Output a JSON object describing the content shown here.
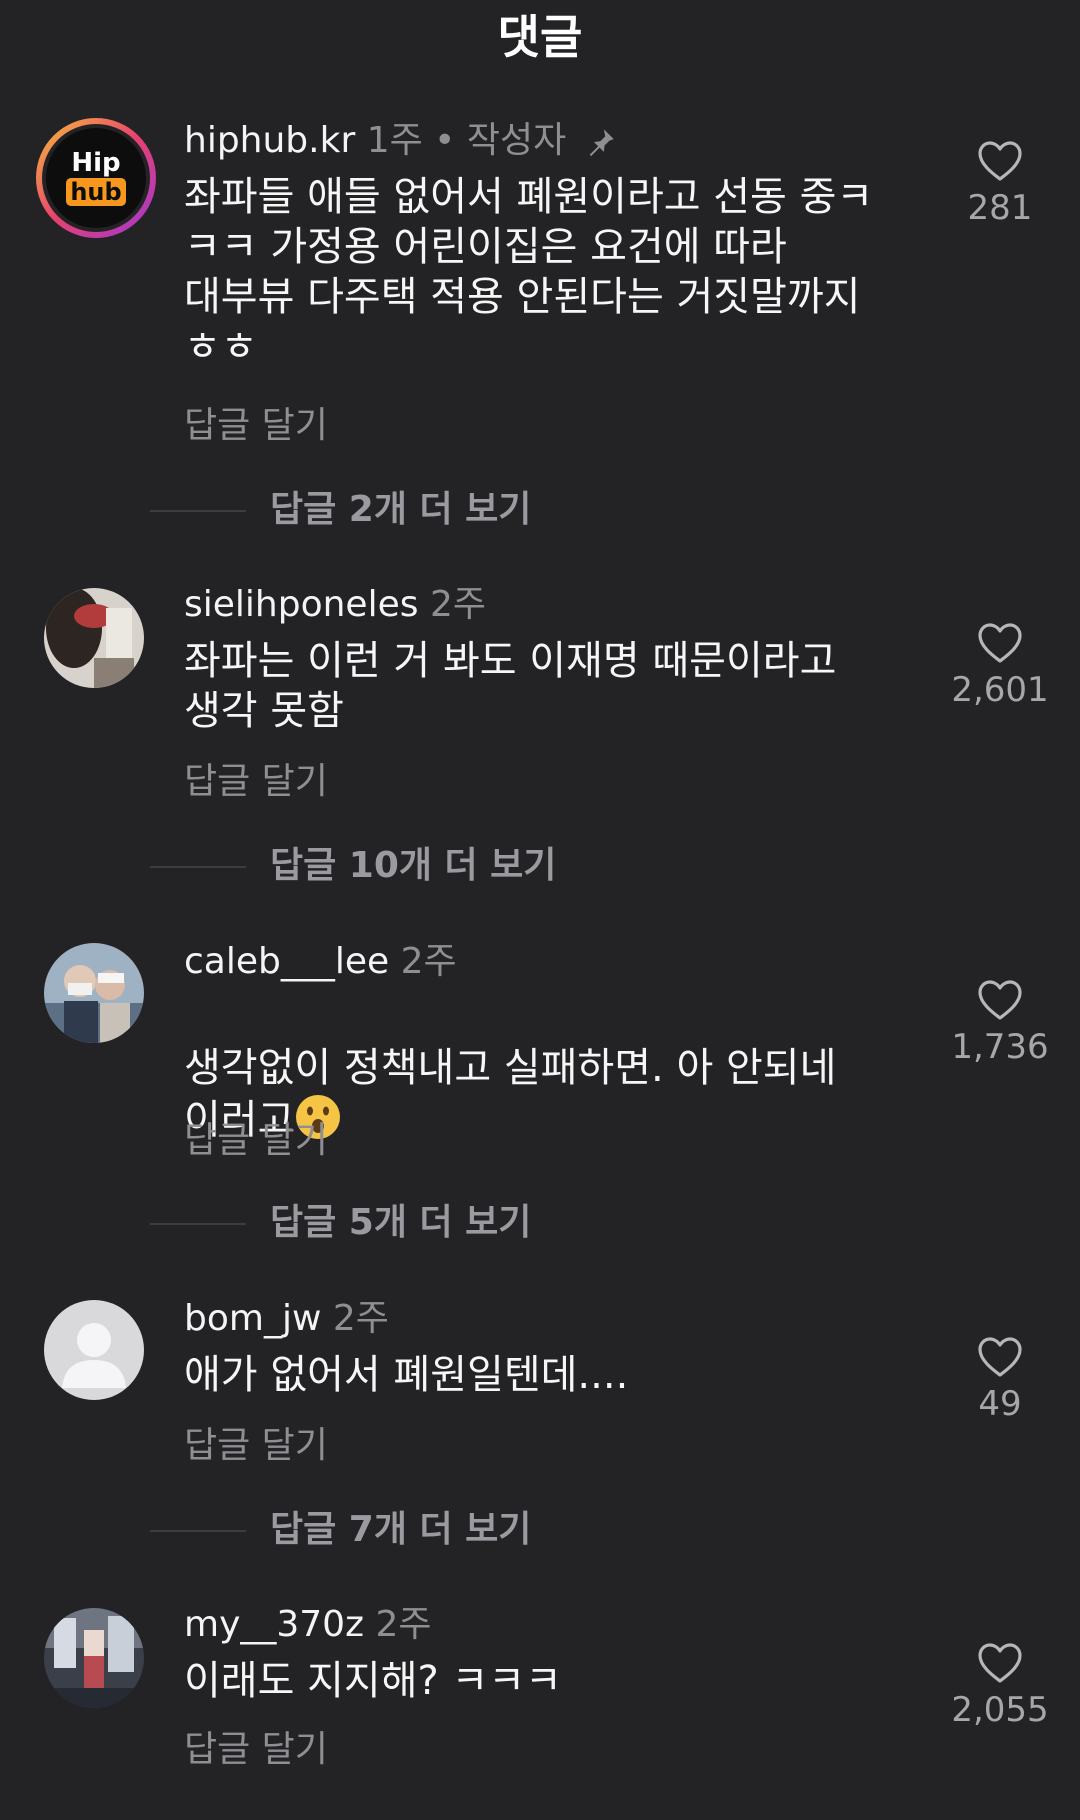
{
  "header": {
    "title": "댓글"
  },
  "labels": {
    "reply": "답글 달기"
  },
  "colors": {
    "background": "#232325",
    "secondary_text": "#8e8e93"
  },
  "comments": [
    {
      "username": "hiphub.kr",
      "meta": "1주 • 작성자",
      "pinned": true,
      "avatar_text_top": "Hip",
      "avatar_text_bottom": "hub",
      "text": "좌파들 애들 없어서 폐원이라고 선동 중ㅋ\nㅋㅋ 가정용 어린이집은 요건에 따라\n대부뷰 다주택 적용 안된다는 거짓말까지\nㅎㅎ",
      "likes": "281",
      "more_replies": "답글 2개 더 보기"
    },
    {
      "username": "sielihponeles",
      "meta": "2주",
      "text": "좌파는 이런 거 봐도 이재명 때문이라고\n생각 못함",
      "likes": "2,601",
      "more_replies": "답글 10개 더 보기"
    },
    {
      "username": "caleb___lee",
      "meta": "2주",
      "text": "생각없이 정책내고 실패하면. 아 안되네\n이러고",
      "emoji": "surprised-face",
      "likes": "1,736",
      "more_replies": "답글 5개 더 보기"
    },
    {
      "username": "bom_jw",
      "meta": "2주",
      "text": "애가 없어서 폐원일텐데....",
      "likes": "49",
      "more_replies": "답글 7개 더 보기"
    },
    {
      "username": "my__370z",
      "meta": "2주",
      "text": "이래도 지지해? ㅋㅋㅋ",
      "likes": "2,055"
    }
  ]
}
